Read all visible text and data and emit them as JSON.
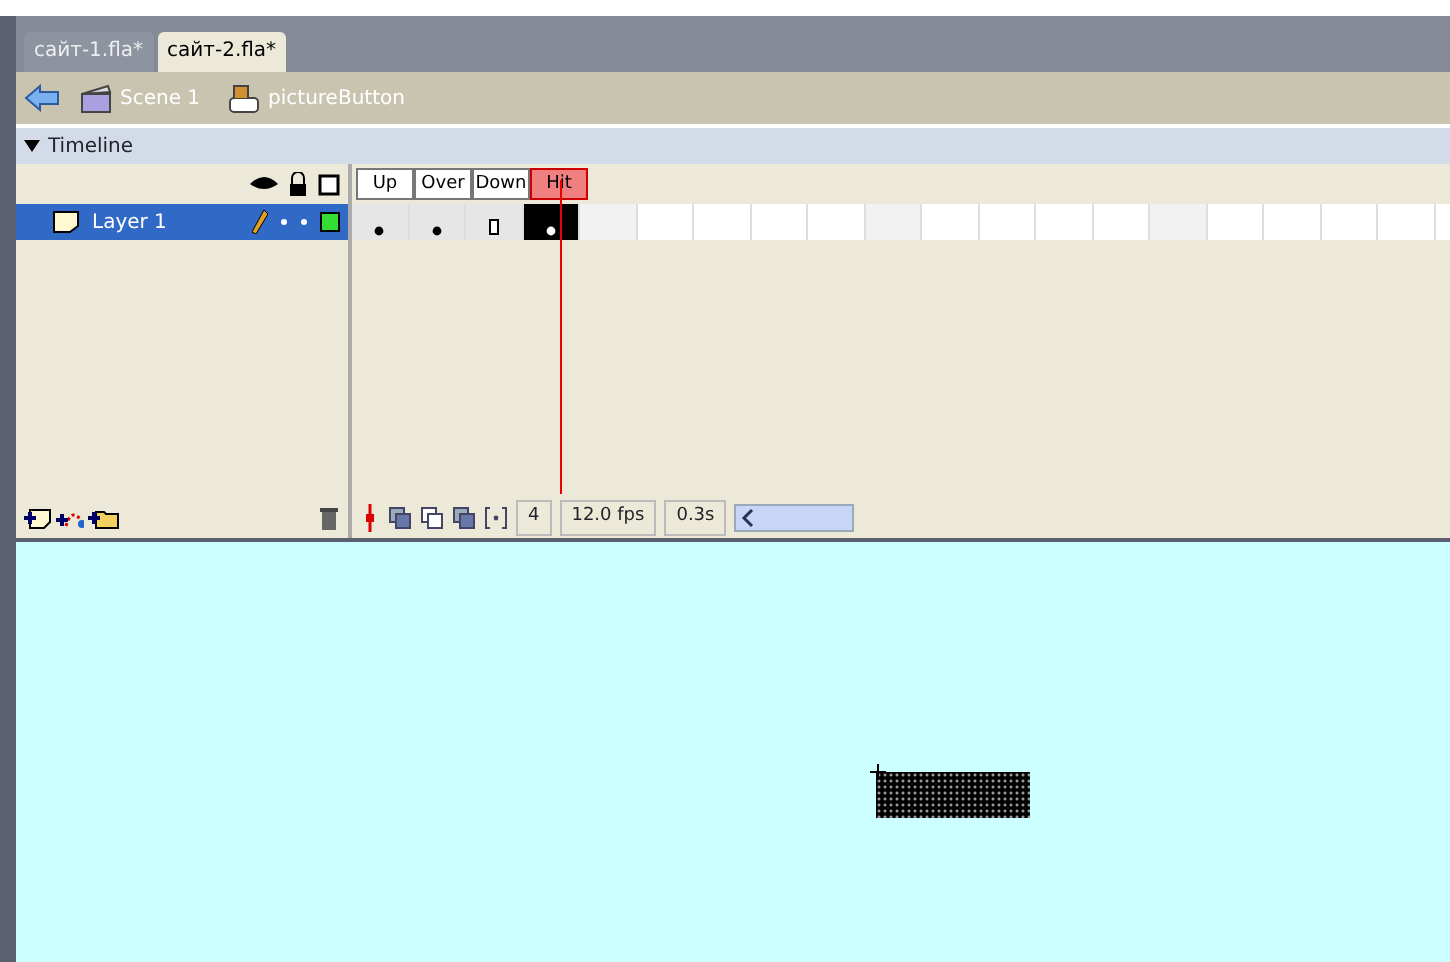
{
  "tabs": [
    {
      "label": "сайт-1.fla*",
      "selected": false
    },
    {
      "label": "сайт-2.fla*",
      "selected": true
    }
  ],
  "breadcrumb": [
    {
      "label": "Scene 1",
      "kind": "scene"
    },
    {
      "label": "pictureButton",
      "kind": "symbol"
    }
  ],
  "timeline": {
    "title": "Timeline",
    "expanded": true,
    "layers": [
      {
        "name": "Layer 1",
        "selected": true,
        "color": "#33dd33"
      }
    ],
    "frame_labels": [
      {
        "label": "Up",
        "selected": false
      },
      {
        "label": "Over",
        "selected": false
      },
      {
        "label": "Down",
        "selected": false
      },
      {
        "label": "Hit",
        "selected": true
      }
    ],
    "frames": [
      {
        "kind": "keyframe",
        "selected": false
      },
      {
        "kind": "keyframe",
        "selected": false
      },
      {
        "kind": "span-end",
        "selected": false
      },
      {
        "kind": "keyframe",
        "selected": true
      }
    ],
    "current_frame": "4",
    "fps": "12.0 fps",
    "time": "0.3s"
  }
}
